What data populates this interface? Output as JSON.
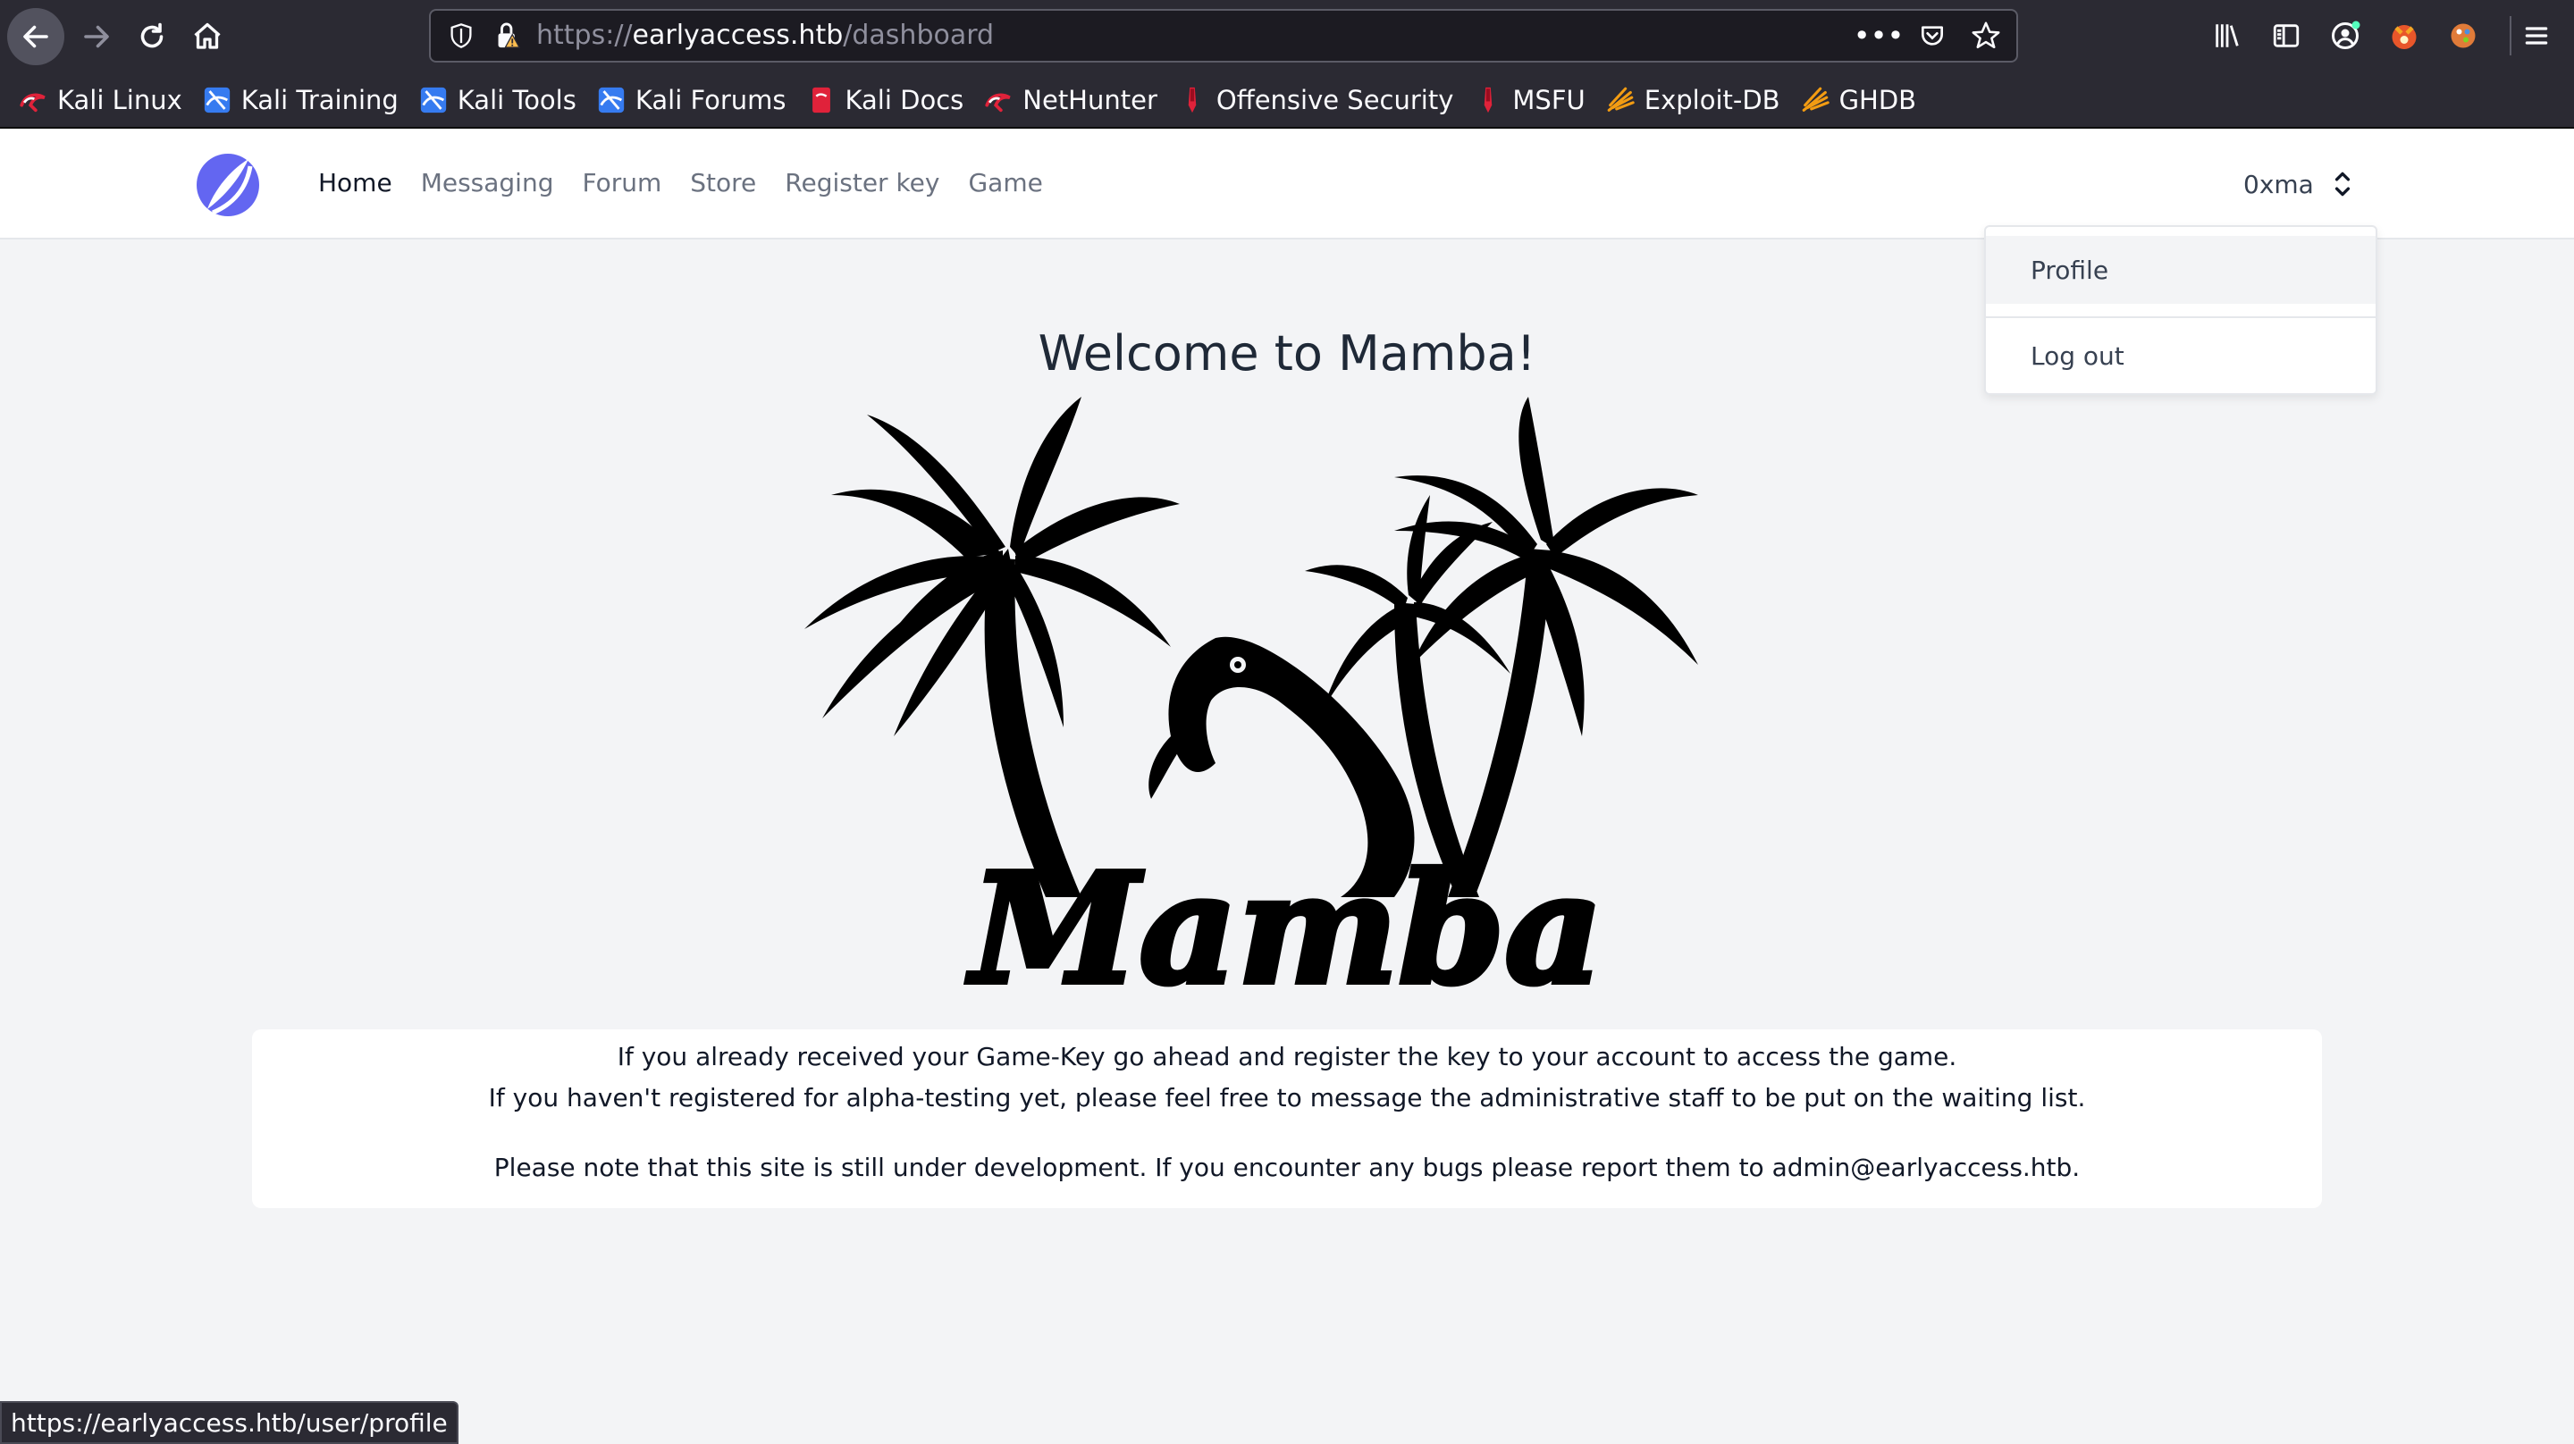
{
  "browser": {
    "url_prefix": "https://",
    "url_host": "earlyaccess.htb",
    "url_path": "/dashboard",
    "url_more": "•••",
    "status_url": "https://earlyaccess.htb/user/profile"
  },
  "bookmarks": [
    {
      "label": "Kali Linux",
      "icon": "kali-icon"
    },
    {
      "label": "Kali Training",
      "icon": "kali-training-icon"
    },
    {
      "label": "Kali Tools",
      "icon": "kali-tools-icon"
    },
    {
      "label": "Kali Forums",
      "icon": "kali-forums-icon"
    },
    {
      "label": "Kali Docs",
      "icon": "kali-docs-icon"
    },
    {
      "label": "NetHunter",
      "icon": "nethunter-icon"
    },
    {
      "label": "Offensive Security",
      "icon": "offsec-icon"
    },
    {
      "label": "MSFU",
      "icon": "msfu-icon"
    },
    {
      "label": "Exploit-DB",
      "icon": "exploitdb-icon"
    },
    {
      "label": "GHDB",
      "icon": "ghdb-icon"
    }
  ],
  "nav": {
    "links": [
      "Home",
      "Messaging",
      "Forum",
      "Store",
      "Register key",
      "Game"
    ],
    "active": "Home",
    "username": "0xma"
  },
  "dropdown": {
    "profile": "Profile",
    "logout": "Log out"
  },
  "main": {
    "welcome": "Welcome to Mamba!",
    "logo_text": "Mamba",
    "line1": "If you already received your Game-Key go ahead and register the key to your account to access the game.",
    "line2": "If you haven't registered for alpha-testing yet, please feel free to message the administrative staff to be put on the waiting list.",
    "line3": "Please note that this site is still under development. If you encounter any bugs please report them to admin@earlyaccess.htb."
  },
  "colors": {
    "chrome_bg": "#2b2a33",
    "page_bg": "#f3f4f6",
    "logo_accent": "#6366f1",
    "text_dark": "#111827"
  }
}
